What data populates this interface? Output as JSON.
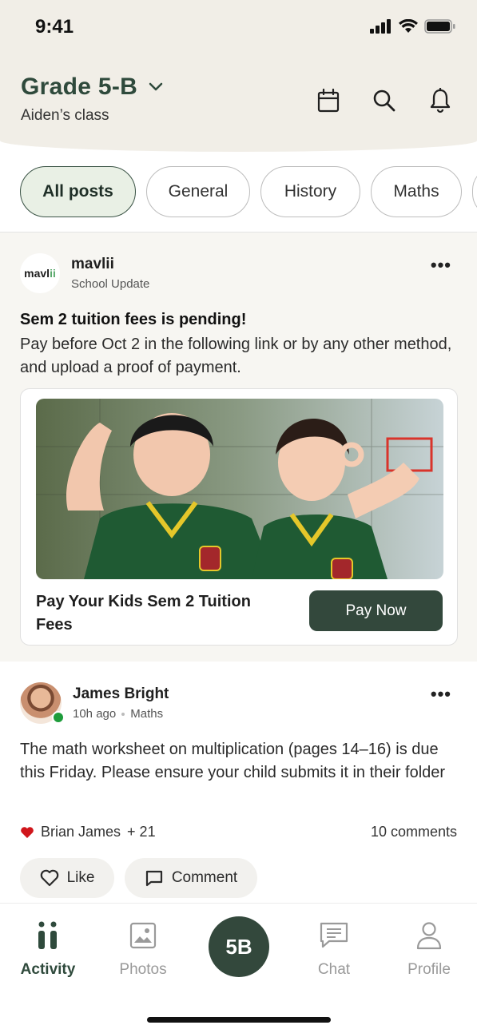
{
  "status_bar": {
    "time": "9:41"
  },
  "header": {
    "class_title": "Grade 5-B",
    "class_subtitle": "Aiden’s class",
    "icons": [
      "calendar-icon",
      "search-icon",
      "bell-icon"
    ]
  },
  "filters": [
    "All posts",
    "General",
    "History",
    "Maths",
    ""
  ],
  "posts": [
    {
      "author": "mavlii",
      "logo_text_a": "mavl",
      "logo_text_b": "ii",
      "meta": "School Update",
      "title": "Sem 2 tuition fees is pending!",
      "body": "Pay before Oct 2 in the following link or by any other method, and upload a proof of payment.",
      "card": {
        "title": "Pay Your Kids Sem 2 Tuition Fees",
        "button": "Pay Now"
      }
    },
    {
      "author": "James Bright",
      "time": "10h ago",
      "tag": "Maths",
      "body": "The math worksheet on multiplication (pages 14–16) is due this Friday. Please ensure your child submits it in their folder",
      "likes_name": "Brian James",
      "likes_extra": "+ 21",
      "comments": "10 comments",
      "like_label": "Like",
      "comment_label": "Comment"
    }
  ],
  "bottom_nav": {
    "items": [
      "Activity",
      "Photos",
      "Chat",
      "Profile"
    ],
    "center_label": "5B",
    "active": "Activity"
  },
  "colors": {
    "brand": "#33483c",
    "chip_active_bg": "#e9f0e5",
    "header_bg": "#f1eee7",
    "online": "#1e9c3b",
    "heart": "#d0161b"
  }
}
